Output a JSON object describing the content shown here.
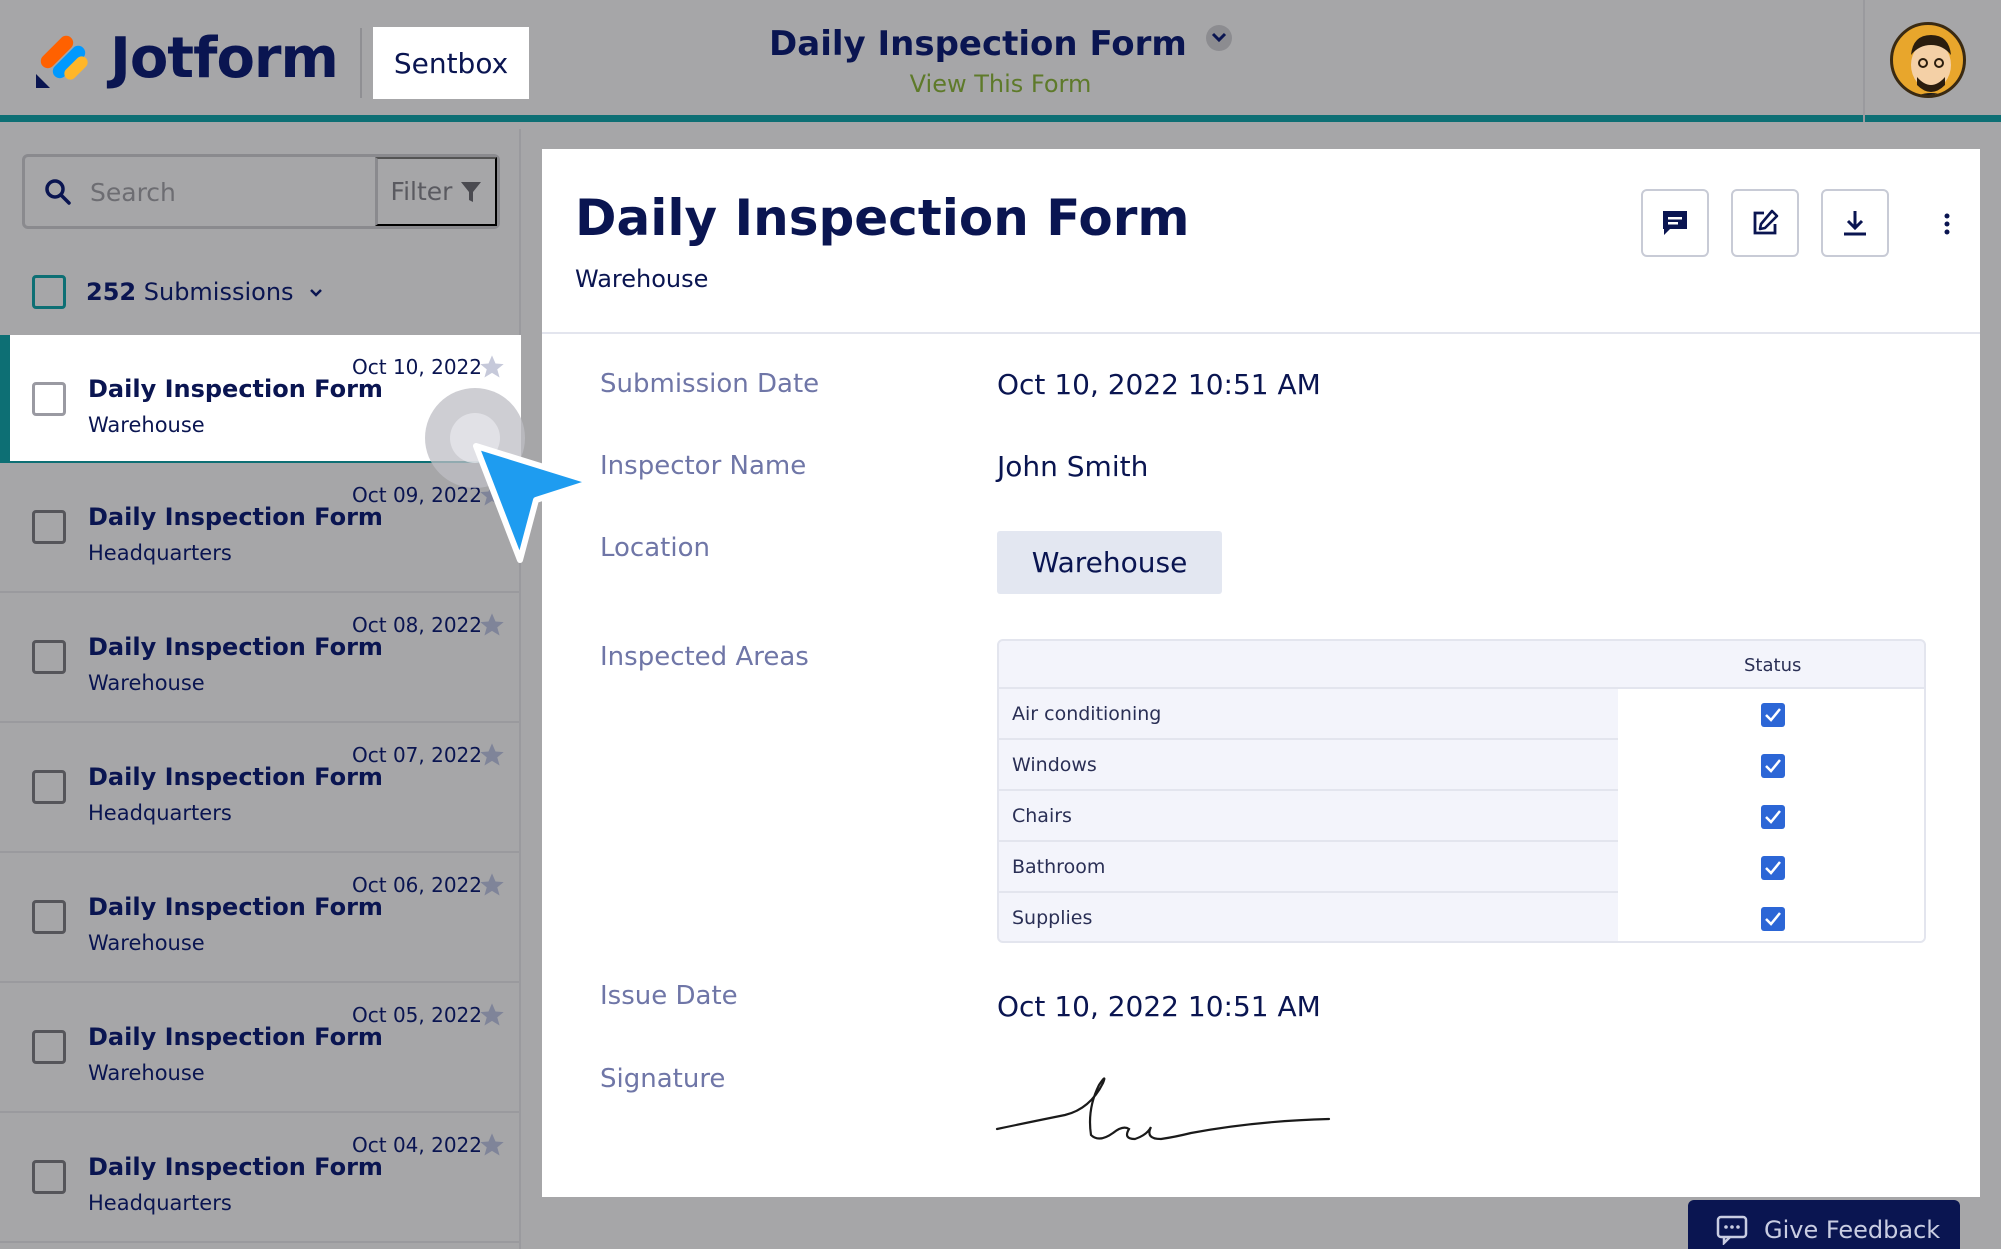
{
  "header": {
    "brand": "Jotform",
    "sentbox_label": "Sentbox",
    "form_title": "Daily Inspection Form",
    "view_form_link": "View This Form"
  },
  "sidebar": {
    "search_placeholder": "Search",
    "filter_label": "Filter",
    "submission_count": "252",
    "submission_count_label": "Submissions",
    "items": [
      {
        "title": "Daily Inspection Form",
        "subtitle": "Warehouse",
        "date": "Oct 10, 2022"
      },
      {
        "title": "Daily Inspection Form",
        "subtitle": "Headquarters",
        "date": "Oct 09, 2022"
      },
      {
        "title": "Daily Inspection Form",
        "subtitle": "Warehouse",
        "date": "Oct 08, 2022"
      },
      {
        "title": "Daily Inspection Form",
        "subtitle": "Headquarters",
        "date": "Oct 07, 2022"
      },
      {
        "title": "Daily Inspection Form",
        "subtitle": "Warehouse",
        "date": "Oct 06, 2022"
      },
      {
        "title": "Daily Inspection Form",
        "subtitle": "Warehouse",
        "date": "Oct 05, 2022"
      },
      {
        "title": "Daily Inspection Form",
        "subtitle": "Headquarters",
        "date": "Oct 04, 2022"
      }
    ]
  },
  "submission": {
    "title": "Daily Inspection Form",
    "subtitle": "Warehouse",
    "fields": {
      "submission_date_label": "Submission Date",
      "submission_date_value": "Oct 10, 2022 10:51 AM",
      "inspector_label": "Inspector Name",
      "inspector_value": "John Smith",
      "location_label": "Location",
      "location_value": "Warehouse",
      "areas_label": "Inspected Areas",
      "issue_date_label": "Issue Date",
      "issue_date_value": "Oct 10, 2022 10:51 AM",
      "signature_label": "Signature"
    },
    "areas_table": {
      "column_header": "Status",
      "rows": [
        {
          "area": "Air conditioning",
          "checked": true
        },
        {
          "area": "Windows",
          "checked": true
        },
        {
          "area": "Chairs",
          "checked": true
        },
        {
          "area": "Bathroom",
          "checked": true
        },
        {
          "area": "Supplies",
          "checked": true
        }
      ]
    }
  },
  "feedback_label": "Give Feedback",
  "colors": {
    "navy": "#0a1551",
    "teal": "#0d6f74",
    "checkbox_blue": "#2c66d6",
    "cursor_blue": "#1e9cf0",
    "link_green": "#5e7a2a"
  }
}
